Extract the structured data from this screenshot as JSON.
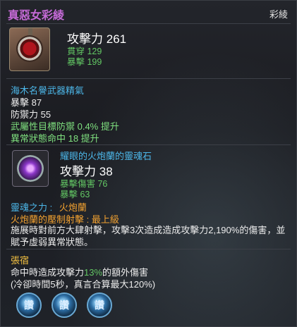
{
  "item": {
    "name": "真惡女彩綾",
    "type_label": "彩綾"
  },
  "base_stats": {
    "attack_label": "攻擊力",
    "attack_value": "261",
    "pierce": "貫穿 129",
    "crit": "暴擊 199"
  },
  "spirit": {
    "name": "海木名譽武器精氣",
    "lines": [
      "暴擊 87",
      "防禦力 55"
    ],
    "bonus_lines": [
      "武屬性目標防禦 0.4% 提升",
      "異常狀態命中 18 提升"
    ]
  },
  "soul_stone": {
    "name": "耀眼的火炮蘭的靈魂石",
    "attack_label": "攻擊力",
    "attack_value": "38",
    "crit_damage": "暴擊傷害 76",
    "crit": "暴擊 63"
  },
  "soul_power": {
    "label": "靈魂之力 :",
    "name": "火炮蘭",
    "skill_title": "火炮蘭的壓制射擊 : 最上級",
    "skill_desc": "施展時對前方大肆射擊，攻擊3次造成造成攻擊力2,190%的傷害，並賦予虛弱異常狀態。"
  },
  "set_effect": {
    "name": "張宿",
    "line1_before": "命中時造成攻擊力",
    "line1_pct": "13%",
    "line1_after": "的額外傷害",
    "line2": "(冷卻時間5秒，真言合算最大120%)"
  },
  "orbs": {
    "glyph": "讚",
    "count": 3
  },
  "colors": {
    "title": "#c46ad6",
    "green": "#63c764",
    "cyan": "#4cb6e8",
    "orange": "#f0a030",
    "set_name": "#f5c242"
  }
}
